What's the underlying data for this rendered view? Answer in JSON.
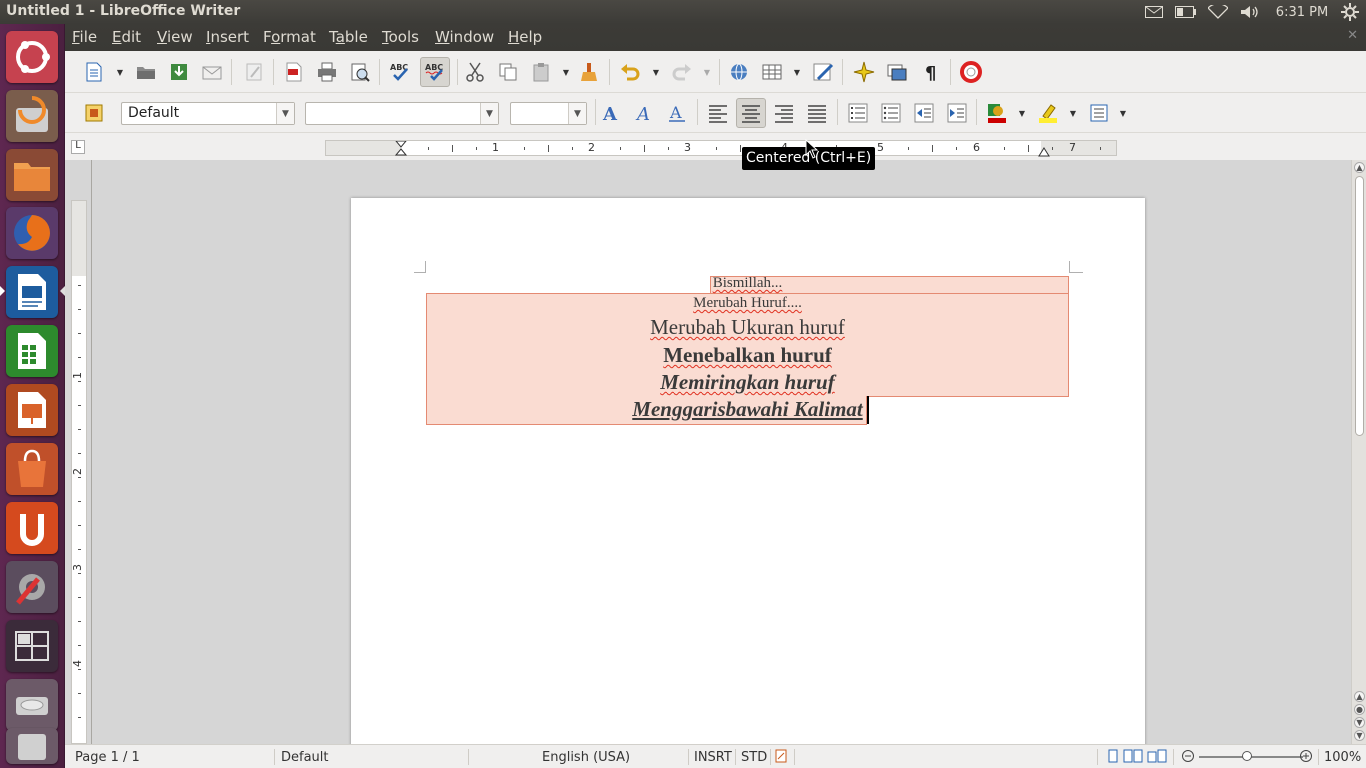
{
  "window": {
    "title": "Untitled 1 - LibreOffice Writer"
  },
  "tray": {
    "clock": "6:31 PM"
  },
  "menubar": {
    "items": [
      {
        "pre": "",
        "u": "F",
        "post": "ile"
      },
      {
        "pre": "",
        "u": "E",
        "post": "dit"
      },
      {
        "pre": "",
        "u": "V",
        "post": "iew"
      },
      {
        "pre": "",
        "u": "I",
        "post": "nsert"
      },
      {
        "pre": "F",
        "u": "o",
        "post": "rmat"
      },
      {
        "pre": "T",
        "u": "a",
        "post": "ble"
      },
      {
        "pre": "",
        "u": "T",
        "post": "ools"
      },
      {
        "pre": "",
        "u": "W",
        "post": "indow"
      },
      {
        "pre": "",
        "u": "H",
        "post": "elp"
      }
    ],
    "close": "✕"
  },
  "formatting": {
    "paragraph_style": "Default",
    "font_name": "",
    "font_size": ""
  },
  "ruler": {
    "corner": "L",
    "h_numbers": [
      "1",
      "2",
      "3",
      "4",
      "5",
      "6",
      "7"
    ],
    "v_numbers": [
      "1",
      "2",
      "3",
      "4"
    ]
  },
  "tooltip": "Centered (Ctrl+E)",
  "document": {
    "lines": [
      "Bismillah...",
      "Merubah Huruf....",
      "Merubah Ukuran huruf",
      "Menebalkan huruf",
      "Memiringkan huruf",
      "Menggarisbawahi Kalimat"
    ]
  },
  "statusbar": {
    "page": "Page 1 / 1",
    "style": "Default",
    "language": "English (USA)",
    "insert_mode": "INSRT",
    "selection_mode": "STD",
    "zoom": "100%"
  },
  "colors": {
    "launcher_bg": "#5e2750",
    "highlight_bg": "#fadcd2",
    "highlight_border": "#e48a72",
    "spell_underline": "#e03020"
  }
}
